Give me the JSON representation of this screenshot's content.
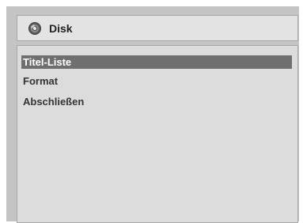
{
  "header": {
    "icon": "disc-icon",
    "title": "Disk"
  },
  "menu": {
    "items": [
      {
        "label": "Titel-Liste",
        "selected": true
      },
      {
        "label": "Format",
        "selected": false
      },
      {
        "label": "Abschließen",
        "selected": false
      }
    ]
  },
  "colors": {
    "frame": "#c4c4c4",
    "header_bg": "#e3e3e3",
    "panel_bg": "#dcdcdc",
    "selection_bg": "#6f6f6f",
    "selection_text": "#ffffff",
    "text": "#333333"
  }
}
